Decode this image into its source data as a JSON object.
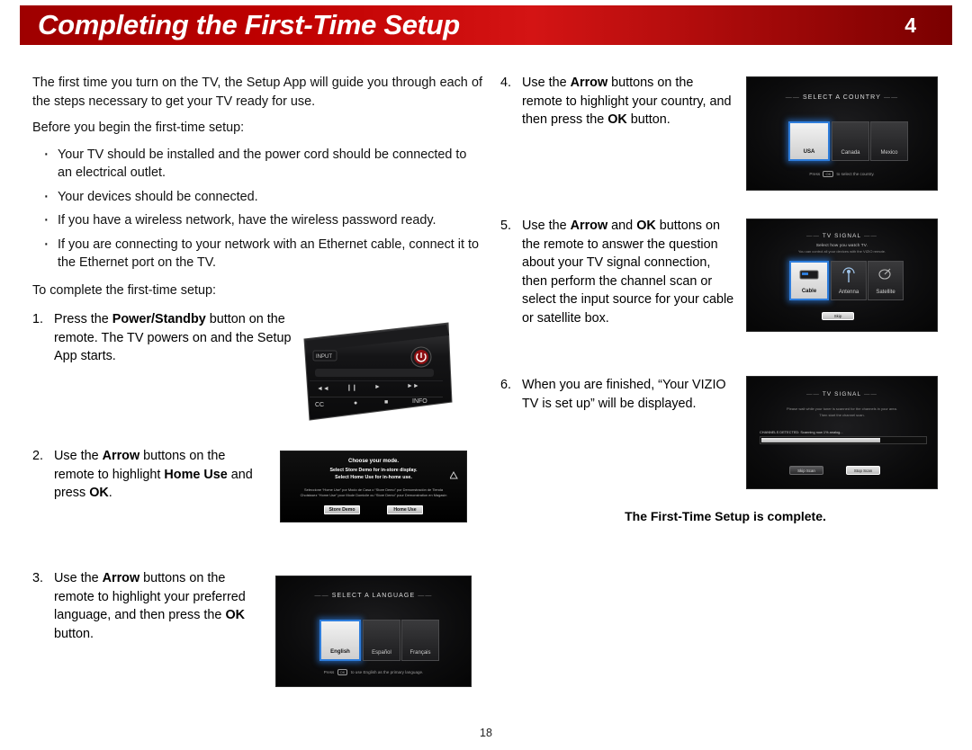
{
  "header": {
    "title": "Completing the First-Time Setup",
    "chapter": "4"
  },
  "page_number": "18",
  "left": {
    "intro1": "The first time you turn on the TV, the Setup App will guide you through each of the steps necessary to get your TV ready for use.",
    "intro2": "Before you begin the first-time setup:",
    "bullets": [
      "Your TV should be installed and the power cord should be connected to an electrical outlet.",
      "Your devices should be connected.",
      "If you have a wireless network, have the wireless password ready.",
      "If you are connecting to your network with an Ethernet cable, connect it to the Ethernet port on the TV."
    ],
    "intro3": "To complete the first-time setup:",
    "steps": [
      {
        "num": "1.",
        "parts": [
          {
            "t": "Press the ",
            "b": false
          },
          {
            "t": "Power/Standby",
            "b": true
          },
          {
            "t": " button on the remote. The TV powers on and the Setup App starts.",
            "b": false
          }
        ]
      },
      {
        "num": "2.",
        "parts": [
          {
            "t": "Use the ",
            "b": false
          },
          {
            "t": "Arrow",
            "b": true
          },
          {
            "t": " buttons on the remote to highlight ",
            "b": false
          },
          {
            "t": "Home Use",
            "b": true
          },
          {
            "t": " and press ",
            "b": false
          },
          {
            "t": "OK",
            "b": true
          },
          {
            "t": ".",
            "b": false
          }
        ]
      },
      {
        "num": "3.",
        "parts": [
          {
            "t": "Use the ",
            "b": false
          },
          {
            "t": "Arrow",
            "b": true
          },
          {
            "t": " buttons on the remote to highlight your preferred language, and then press the ",
            "b": false
          },
          {
            "t": "OK",
            "b": true
          },
          {
            "t": " button.",
            "b": false
          }
        ]
      }
    ]
  },
  "right": {
    "steps": [
      {
        "num": "4.",
        "parts": [
          {
            "t": "Use the ",
            "b": false
          },
          {
            "t": "Arrow",
            "b": true
          },
          {
            "t": " buttons on the remote to highlight your country, and then press the ",
            "b": false
          },
          {
            "t": "OK",
            "b": true
          },
          {
            "t": " button.",
            "b": false
          }
        ]
      },
      {
        "num": "5.",
        "parts": [
          {
            "t": "Use the ",
            "b": false
          },
          {
            "t": "Arrow",
            "b": true
          },
          {
            "t": " and ",
            "b": false
          },
          {
            "t": "OK",
            "b": true
          },
          {
            "t": " buttons on the remote to answer the question about your TV signal connection, then perform the channel scan or select the input source for your cable or satellite box.",
            "b": false
          }
        ]
      },
      {
        "num": "6.",
        "parts": [
          {
            "t": "When you are finished, “Your VIZIO TV is set up” will be displayed.",
            "b": false
          }
        ]
      }
    ],
    "complete_note": "The First-Time Setup is complete."
  },
  "screens": {
    "mode": {
      "line1": "Choose your mode.",
      "line2": "Select Store Demo for in-store display.",
      "line3": "Select Home Use for in-home use.",
      "small": "Seleccione “Home Use” por Modo de Casa o “Store Demo” por Demonstración de Tienda\nChoisissez “Home Use” pour Mode Domicile ou “Store Demo” pour Demonstration en Magasin",
      "btn_store": "Store Demo",
      "btn_home": "Home Use"
    },
    "language": {
      "title": "SELECT A LANGUAGE",
      "tiles": [
        "English",
        "Español",
        "Français"
      ],
      "selected": "English",
      "footer_pre": "Press",
      "footer_key": "OK",
      "footer_post": "to use English as the primary language."
    },
    "country": {
      "title": "SELECT A COUNTRY",
      "tiles": [
        "USA",
        "Canada",
        "Mexico"
      ],
      "selected": "USA",
      "footer_pre": "Press",
      "footer_key": "OK",
      "footer_post": "to select the country."
    },
    "signal": {
      "title": "TV SIGNAL",
      "sub": "Select how you watch TV.",
      "sub2": "You can control all your devices with the VIZIO remote.",
      "tiles": [
        "Cable",
        "Antenna",
        "Satellite"
      ],
      "selected": "Cable",
      "button": "Skip"
    },
    "scan": {
      "title": "TV SIGNAL",
      "sub": "Please wait while your tuner is scanned for the channels in your area.",
      "sub2": "Then start the channel scan.",
      "status": "CHANNELS DETECTED:  Scanning now 1% analog...",
      "progress_percent": 72,
      "btn_left": "Skip Scan",
      "btn_right": "Stop Scan"
    }
  }
}
